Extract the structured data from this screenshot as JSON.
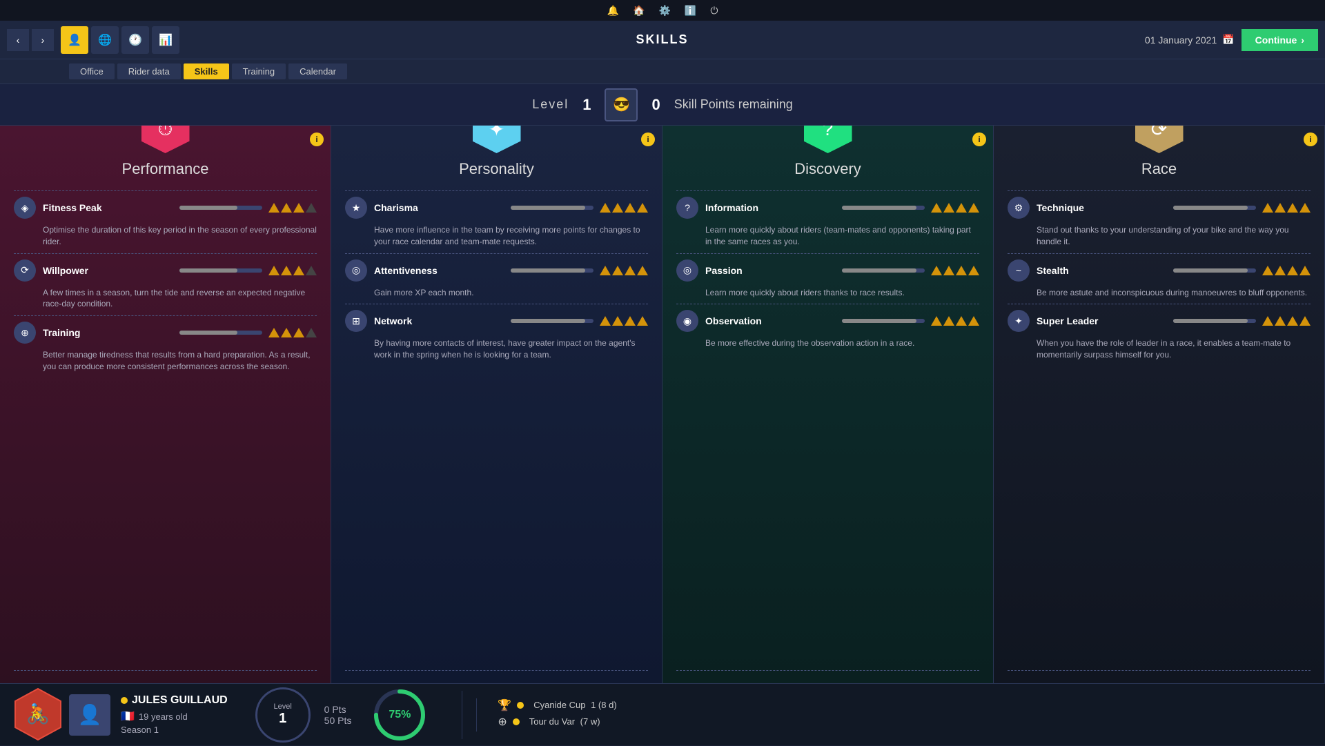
{
  "systemBar": {
    "icons": [
      "🔔",
      "🏠",
      "⚙️",
      "ℹ️",
      "⏻"
    ]
  },
  "navBar": {
    "title": "SKILLS",
    "date": "01 January 2021",
    "continueLabel": "Continue",
    "icons": [
      {
        "name": "profile",
        "symbol": "👤",
        "active": true
      },
      {
        "name": "globe",
        "symbol": "🌐",
        "active": false
      },
      {
        "name": "clock",
        "symbol": "🕐",
        "active": false
      },
      {
        "name": "chart",
        "symbol": "📊",
        "active": false
      }
    ]
  },
  "subTabs": [
    {
      "label": "Office",
      "active": false
    },
    {
      "label": "Rider data",
      "active": false
    },
    {
      "label": "Skills",
      "active": true
    },
    {
      "label": "Training",
      "active": false
    },
    {
      "label": "Calendar",
      "active": false
    }
  ],
  "levelBar": {
    "levelLabel": "Level",
    "levelNum": "1",
    "skillPointsNum": "0",
    "skillPointsLabel": "Skill Points remaining"
  },
  "cards": [
    {
      "id": "performance",
      "title": "Performance",
      "hexColor": "hex-red",
      "hexSymbol": "⏱",
      "skills": [
        {
          "name": "Fitness Peak",
          "icon": "◈",
          "description": "Optimise the duration of this key period in the season of every professional rider.",
          "bars": 3,
          "maxBars": 4
        },
        {
          "name": "Willpower",
          "icon": "⟳",
          "description": "A few times in a season, turn the tide and reverse an expected negative race-day condition.",
          "bars": 3,
          "maxBars": 4
        },
        {
          "name": "Training",
          "icon": "⊕",
          "description": "Better manage tiredness that results from a hard preparation. As a result, you can produce more consistent performances across the season.",
          "bars": 3,
          "maxBars": 4
        }
      ]
    },
    {
      "id": "personality",
      "title": "Personality",
      "hexColor": "hex-cyan",
      "hexSymbol": "✦",
      "skills": [
        {
          "name": "Charisma",
          "icon": "★",
          "description": "Have more influence in the team by receiving more points for changes to your race calendar and team-mate requests.",
          "bars": 4,
          "maxBars": 4
        },
        {
          "name": "Attentiveness",
          "icon": "◎",
          "description": "Gain more XP each month.",
          "bars": 4,
          "maxBars": 4
        },
        {
          "name": "Network",
          "icon": "⊞",
          "description": "By having more contacts of interest, have greater impact on the agent's work in the spring when he is looking for a team.",
          "bars": 4,
          "maxBars": 4
        }
      ]
    },
    {
      "id": "discovery",
      "title": "Discovery",
      "hexColor": "hex-green",
      "hexSymbol": "?",
      "skills": [
        {
          "name": "Information",
          "icon": "?",
          "description": "Learn more quickly about riders (team-mates and opponents) taking part in the same races as you.",
          "bars": 4,
          "maxBars": 4
        },
        {
          "name": "Passion",
          "icon": "◎",
          "description": "Learn more quickly about riders thanks to race results.",
          "bars": 4,
          "maxBars": 4
        },
        {
          "name": "Observation",
          "icon": "◉",
          "description": "Be more effective during the observation action in a race.",
          "bars": 4,
          "maxBars": 4
        }
      ]
    },
    {
      "id": "race",
      "title": "Race",
      "hexColor": "hex-tan",
      "hexSymbol": "⟳",
      "skills": [
        {
          "name": "Technique",
          "icon": "⚙",
          "description": "Stand out thanks to your understanding of your bike and the way you handle it.",
          "bars": 4,
          "maxBars": 4
        },
        {
          "name": "Stealth",
          "icon": "~",
          "description": "Be more astute and inconspicuous during manoeuvres to bluff opponents.",
          "bars": 4,
          "maxBars": 4
        },
        {
          "name": "Super Leader",
          "icon": "✦",
          "description": "When you have the role of leader in a race, it enables a team-mate to momentarily surpass himself for you.",
          "bars": 4,
          "maxBars": 4
        }
      ]
    }
  ],
  "bottomBar": {
    "riderName": "JULES GUILLAUD",
    "riderAge": "19 years old",
    "riderSeason": "Season 1",
    "levelLabel": "Level",
    "levelNum": "1",
    "ptsCurrentLabel": "0 Pts",
    "ptsTotalLabel": "50 Pts",
    "progressPercent": "75%",
    "races": [
      {
        "icon": "🏆",
        "name": "Cyanide Cup",
        "detail": "1 (8 d)"
      },
      {
        "icon": "⊕",
        "name": "Tour du Var",
        "detail": "(7 w)"
      }
    ]
  }
}
